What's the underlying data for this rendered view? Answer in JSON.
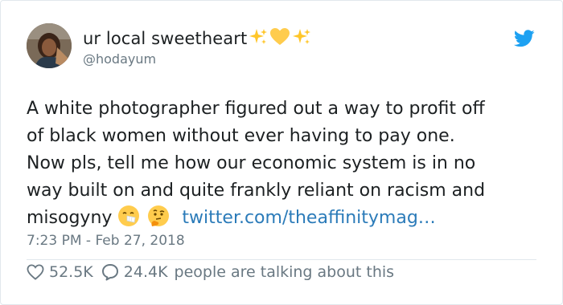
{
  "author": {
    "display_name": "ur local sweetheart",
    "handle": "@hodayum",
    "name_emojis": [
      "sparkles-icon",
      "yellow-heart-icon",
      "sparkles-icon"
    ]
  },
  "tweet": {
    "lines": [
      "A white photographer figured out a way to profit off",
      "of black women without ever having to pay one.",
      "Now pls, tell me how our economic system is in no",
      "way built on and quite frankly reliant on racism and"
    ],
    "last_line_text": "misogyny",
    "last_line_emojis": [
      "sneezing-face-icon",
      "thinking-face-icon"
    ],
    "link_text": "twitter.com/theaffinitymag…",
    "timestamp": "7:23 PM - Feb 27, 2018"
  },
  "stats": {
    "likes": "52.5K",
    "replies": "24.4K",
    "talking_text": "people are talking about this"
  },
  "colors": {
    "text": "#1c2022",
    "muted": "#697882",
    "link": "#2b7bb9",
    "twitter_blue": "#1da1f2",
    "divider": "#e1e8ed"
  },
  "icons": {
    "brand": "twitter-bird-icon",
    "like": "heart-outline-icon",
    "reply": "speech-bubble-icon"
  }
}
